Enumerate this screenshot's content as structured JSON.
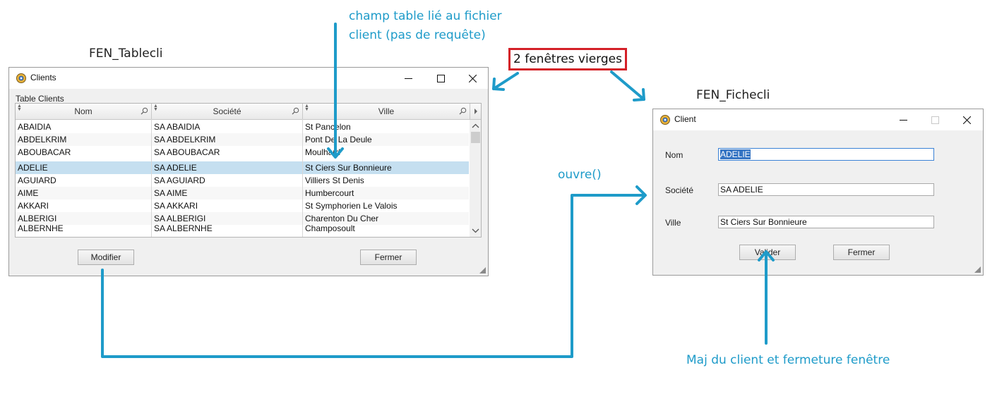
{
  "annotations": {
    "champ_table_line1": "champ table lié au fichier",
    "champ_table_line2": "client (pas de requête)",
    "two_windows": "2 fenêtres vierges",
    "ouvre": "ouvre()",
    "maj": "Maj du client et fermeture fenêtre"
  },
  "captions": {
    "left": "FEN_Tablecli",
    "right": "FEN_Fichecli"
  },
  "clients_window": {
    "title": "Clients",
    "table_label": "Table Clients",
    "columns": [
      "Nom",
      "Société",
      "Ville"
    ],
    "rows": [
      {
        "nom": "ABAIDIA",
        "societe": "SA ABAIDIA",
        "ville": "St Pancelon"
      },
      {
        "nom": "ABDELKRIM",
        "societe": "SA ABDELKRIM",
        "ville": "Pont De La Deule"
      },
      {
        "nom": "ABOUBACAR",
        "societe": "SA ABOUBACAR",
        "ville": "Moulhard"
      },
      {
        "nom": "ADELIE",
        "societe": "SA ADELIE",
        "ville": "St Ciers Sur Bonnieure"
      },
      {
        "nom": "AGUIARD",
        "societe": "SA AGUIARD",
        "ville": "Villiers St Denis"
      },
      {
        "nom": "AIME",
        "societe": "SA AIME",
        "ville": "Humbercourt"
      },
      {
        "nom": "AKKARI",
        "societe": "SA AKKARI",
        "ville": "St Symphorien Le Valois"
      },
      {
        "nom": "ALBERIGI",
        "societe": "SA ALBERIGI",
        "ville": "Charenton Du Cher"
      },
      {
        "nom": "ALBERNHE",
        "societe": "SA ALBERNHE",
        "ville": "Champosoult"
      }
    ],
    "selected_row": 3,
    "buttons": {
      "modify": "Modifier",
      "close": "Fermer"
    }
  },
  "client_window": {
    "title": "Client",
    "labels": {
      "nom": "Nom",
      "societe": "Société",
      "ville": "Ville"
    },
    "values": {
      "nom": "ADELIE",
      "societe": "SA ADELIE",
      "ville": "St Ciers Sur Bonnieure"
    },
    "buttons": {
      "validate": "Valider",
      "close": "Fermer"
    }
  },
  "colors": {
    "annotation": "#1e9bc9",
    "highlight_box": "#d42028",
    "selection": "#c5dff0"
  },
  "icons": {
    "window_icon": "gear-window-icon",
    "minimize": "minimize-icon",
    "maximize": "maximize-icon",
    "close": "close-icon",
    "search": "magnifier-icon",
    "sort": "sort-arrows-icon"
  }
}
